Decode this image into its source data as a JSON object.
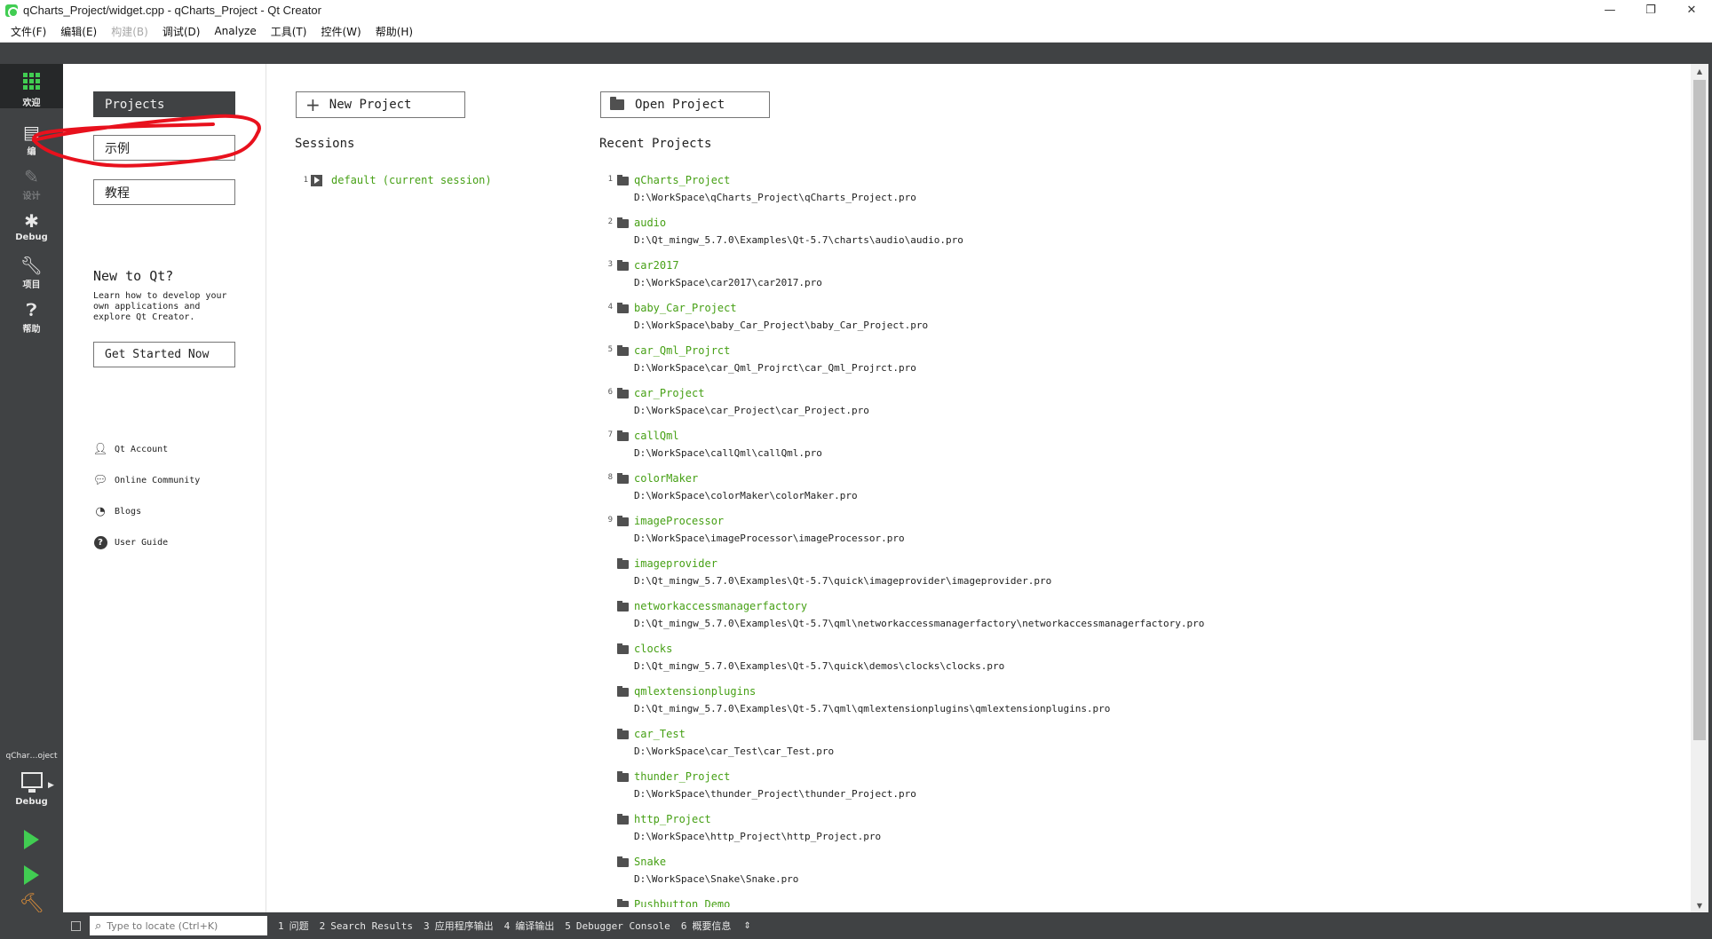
{
  "window": {
    "title": "qCharts_Project/widget.cpp - qCharts_Project - Qt Creator",
    "minimize": "—",
    "maximize": "❐",
    "close": "✕"
  },
  "menu": [
    "文件(F)",
    "编辑(E)",
    "构建(B)",
    "调试(D)",
    "Analyze",
    "工具(T)",
    "控件(W)",
    "帮助(H)"
  ],
  "menu_disabled_index": 2,
  "modes": {
    "welcome": "欢迎",
    "edit": "编",
    "design": "设计",
    "debug": "Debug",
    "projects": "项目",
    "help": "帮助"
  },
  "kit": {
    "project": "qChar…oject",
    "config": "Debug"
  },
  "side": {
    "projects": "Projects",
    "examples": "示例",
    "tutorials": "教程",
    "new_to_qt": "New to Qt?",
    "new_desc": "Learn how to develop your own applications and explore Qt Creator.",
    "get_started": "Get Started Now",
    "links": {
      "account": "Qt Account",
      "community": "Online Community",
      "blogs": "Blogs",
      "guide": "User Guide"
    }
  },
  "main": {
    "new_project": "New Project",
    "open_project": "Open Project",
    "sessions_title": "Sessions",
    "recent_title": "Recent Projects",
    "session": {
      "index": "1",
      "name": "default (current session)"
    },
    "projects": [
      {
        "num": "1",
        "name": "qCharts_Project",
        "path": "D:\\WorkSpace\\qCharts_Project\\qCharts_Project.pro"
      },
      {
        "num": "2",
        "name": "audio",
        "path": "D:\\Qt_mingw_5.7.0\\Examples\\Qt-5.7\\charts\\audio\\audio.pro"
      },
      {
        "num": "3",
        "name": "car2017",
        "path": "D:\\WorkSpace\\car2017\\car2017.pro"
      },
      {
        "num": "4",
        "name": "baby_Car_Project",
        "path": "D:\\WorkSpace\\baby_Car_Project\\baby_Car_Project.pro"
      },
      {
        "num": "5",
        "name": "car_Qml_Projrct",
        "path": "D:\\WorkSpace\\car_Qml_Projrct\\car_Qml_Projrct.pro"
      },
      {
        "num": "6",
        "name": "car_Project",
        "path": "D:\\WorkSpace\\car_Project\\car_Project.pro"
      },
      {
        "num": "7",
        "name": "callQml",
        "path": "D:\\WorkSpace\\callQml\\callQml.pro"
      },
      {
        "num": "8",
        "name": "colorMaker",
        "path": "D:\\WorkSpace\\colorMaker\\colorMaker.pro"
      },
      {
        "num": "9",
        "name": "imageProcessor",
        "path": "D:\\WorkSpace\\imageProcessor\\imageProcessor.pro"
      },
      {
        "num": "",
        "name": "imageprovider",
        "path": "D:\\Qt_mingw_5.7.0\\Examples\\Qt-5.7\\quick\\imageprovider\\imageprovider.pro"
      },
      {
        "num": "",
        "name": "networkaccessmanagerfactory",
        "path": "D:\\Qt_mingw_5.7.0\\Examples\\Qt-5.7\\qml\\networkaccessmanagerfactory\\networkaccessmanagerfactory.pro"
      },
      {
        "num": "",
        "name": "clocks",
        "path": "D:\\Qt_mingw_5.7.0\\Examples\\Qt-5.7\\quick\\demos\\clocks\\clocks.pro"
      },
      {
        "num": "",
        "name": "qmlextensionplugins",
        "path": "D:\\Qt_mingw_5.7.0\\Examples\\Qt-5.7\\qml\\qmlextensionplugins\\qmlextensionplugins.pro"
      },
      {
        "num": "",
        "name": "car_Test",
        "path": "D:\\WorkSpace\\car_Test\\car_Test.pro"
      },
      {
        "num": "",
        "name": "thunder_Project",
        "path": "D:\\WorkSpace\\thunder_Project\\thunder_Project.pro"
      },
      {
        "num": "",
        "name": "http_Project",
        "path": "D:\\WorkSpace\\http_Project\\http_Project.pro"
      },
      {
        "num": "",
        "name": "Snake",
        "path": "D:\\WorkSpace\\Snake\\Snake.pro"
      },
      {
        "num": "",
        "name": "Pushbutton_Demo",
        "path": ""
      }
    ]
  },
  "statusbar": {
    "locator_placeholder": "Type to locate (Ctrl+K)",
    "tabs": [
      {
        "n": "1",
        "label": "问题"
      },
      {
        "n": "2",
        "label": "Search Results"
      },
      {
        "n": "3",
        "label": "应用程序输出"
      },
      {
        "n": "4",
        "label": "编译输出"
      },
      {
        "n": "5",
        "label": "Debugger Console"
      },
      {
        "n": "6",
        "label": "概要信息"
      }
    ]
  },
  "colors": {
    "sidebar": "#404244",
    "accent_green": "#46a015",
    "annotation_red": "#e8111d"
  }
}
